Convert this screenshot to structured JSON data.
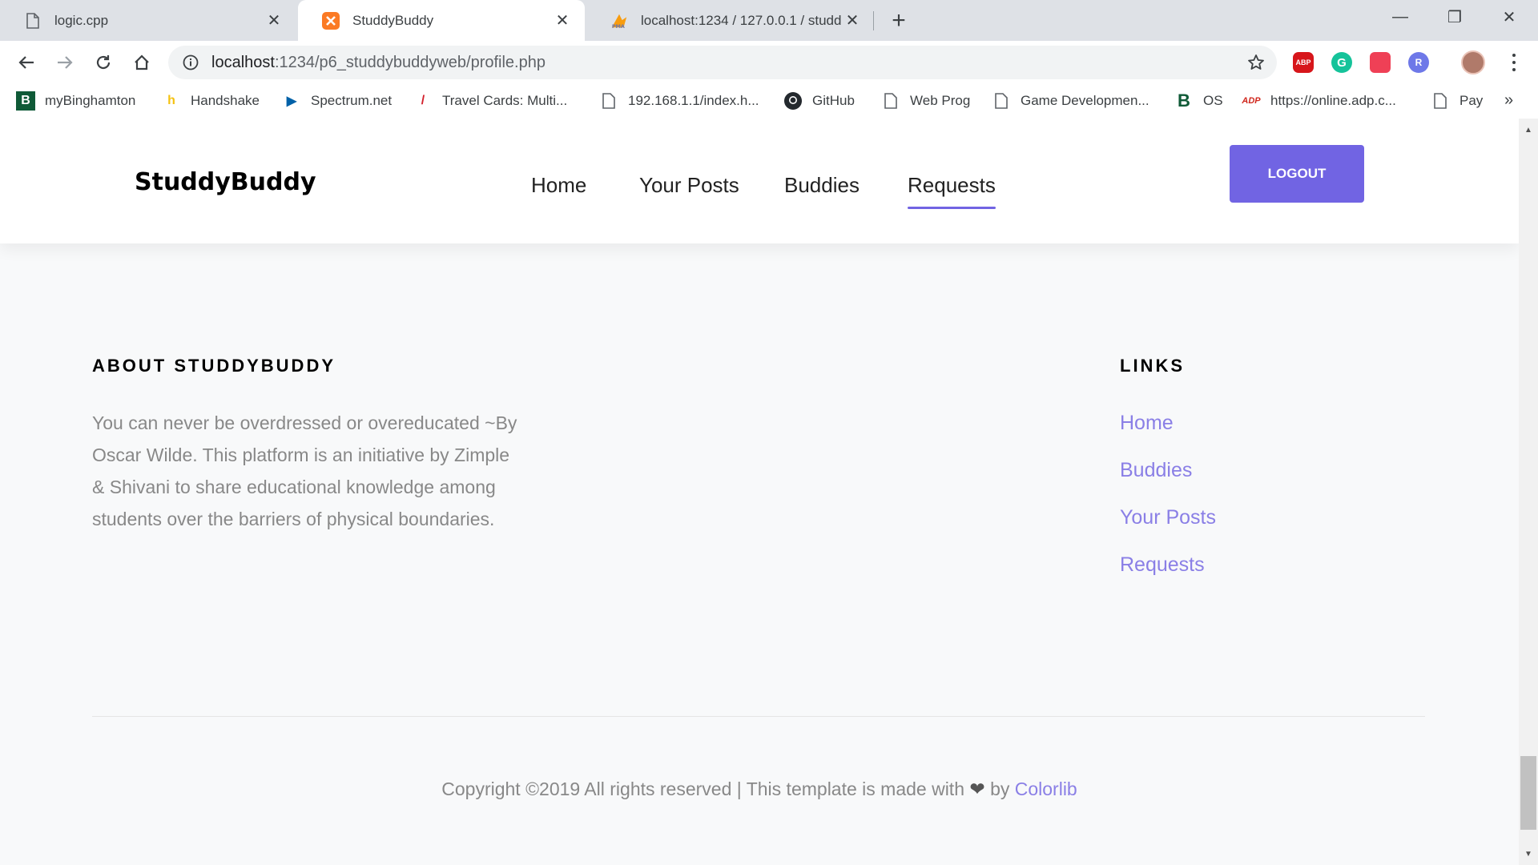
{
  "tabs": [
    {
      "title": "logic.cpp",
      "icon": "file-icon"
    },
    {
      "title": "StuddyBuddy",
      "icon": "xampp-icon"
    },
    {
      "title": "localhost:1234 / 127.0.0.1 / studd",
      "icon": "phpmyadmin-icon"
    }
  ],
  "window": {
    "minimize": "—",
    "restore": "❐",
    "close": "✕"
  },
  "toolbar": {
    "url_host": "localhost",
    "url_rest": ":1234/p6_studdybuddyweb/profile.php"
  },
  "extensions": [
    "ABP",
    "G",
    "",
    "R"
  ],
  "bookmarks": [
    {
      "label": "myBinghamton",
      "icon": "B"
    },
    {
      "label": "Handshake",
      "icon": "h"
    },
    {
      "label": "Spectrum.net",
      "icon": "▶"
    },
    {
      "label": "Travel Cards: Multi...",
      "icon": "/"
    },
    {
      "label": "192.168.1.1/index.h...",
      "icon": "file"
    },
    {
      "label": "GitHub",
      "icon": "gh"
    },
    {
      "label": "Web Prog",
      "icon": "file"
    },
    {
      "label": "Game Developmen...",
      "icon": "file"
    },
    {
      "label": "OS",
      "icon": "B"
    },
    {
      "label": "https://online.adp.c...",
      "icon": "ADP"
    },
    {
      "label": "Pay",
      "icon": "file"
    }
  ],
  "bookmarks_more": "»",
  "site": {
    "brand": "StuddyBuddy",
    "nav": [
      "Home",
      "Your Posts",
      "Buddies",
      "Requests"
    ],
    "active_nav": "Requests",
    "logout": "LOGOUT"
  },
  "footer": {
    "about_title": "ABOUT STUDDYBUDDY",
    "about_text": "You can never be overdressed or overeducated ~By Oscar Wilde. This platform is an initiative by Zimple & Shivani to share educational knowledge among students over the barriers of physical boundaries.",
    "links_title": "LINKS",
    "links": [
      "Home",
      "Buddies",
      "Your Posts",
      "Requests"
    ],
    "copyright_prefix": "Copyright ©2019 All rights reserved | This template is made with",
    "heart": "❤",
    "copyright_by": "by",
    "credit": "Colorlib"
  },
  "colors": {
    "accent": "#7164e3",
    "link": "#8a7fe6"
  }
}
